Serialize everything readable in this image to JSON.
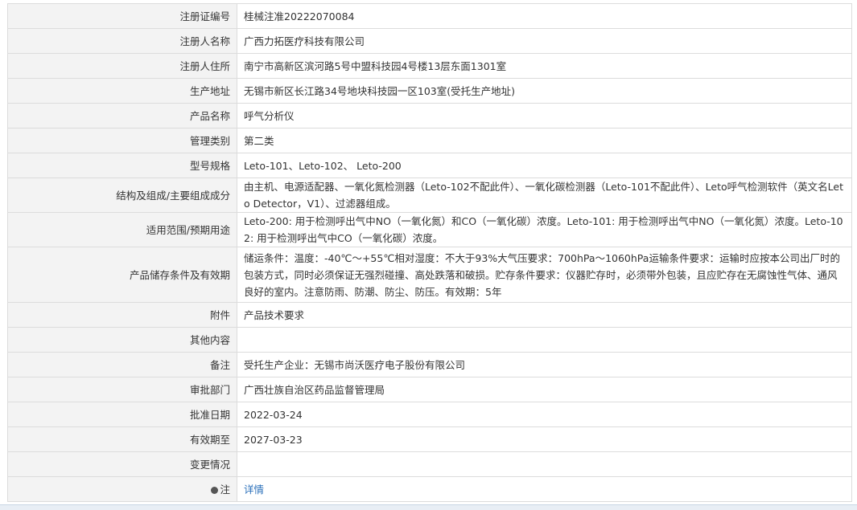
{
  "rows": [
    {
      "label": "注册证编号",
      "value": "桂械注准20222070084"
    },
    {
      "label": "注册人名称",
      "value": "广西力拓医疗科技有限公司"
    },
    {
      "label": "注册人住所",
      "value": "南宁市高新区滨河路5号中盟科技园4号楼13层东面1301室"
    },
    {
      "label": "生产地址",
      "value": "无锡市新区长江路34号地块科技园一区103室(受托生产地址)"
    },
    {
      "label": "产品名称",
      "value": "呼气分析仪"
    },
    {
      "label": "管理类别",
      "value": "第二类"
    },
    {
      "label": "型号规格",
      "value": "Leto-101、Leto-102、 Leto-200"
    },
    {
      "label": "结构及组成/主要组成成分",
      "value": "由主机、电源适配器、一氧化氮检测器（Leto-102不配此件）、一氧化碳检测器（Leto-101不配此件）、Leto呼气检测软件（英文名Leto Detector，V1）、过滤器组成。"
    },
    {
      "label": "适用范围/预期用途",
      "value": "Leto-200: 用于检测呼出气中NO（一氧化氮）和CO（一氧化碳）浓度。Leto-101: 用于检测呼出气中NO（一氧化氮）浓度。Leto-102: 用于检测呼出气中CO（一氧化碳）浓度。"
    },
    {
      "label": "产品储存条件及有效期",
      "value": "储运条件：温度：-40℃～+55℃相对湿度：不大于93%大气压要求：700hPa～1060hPa运输条件要求：运输时应按本公司出厂时的包装方式，同时必须保证无强烈碰撞、高处跌落和破损。贮存条件要求：仪器贮存时，必须带外包装，且应贮存在无腐蚀性气体、通风良好的室内。注意防雨、防潮、防尘、防压。有效期：5年"
    },
    {
      "label": "附件",
      "value": "产品技术要求"
    },
    {
      "label": "其他内容",
      "value": ""
    },
    {
      "label": "备注",
      "value": "受托生产企业：无锡市尚沃医疗电子股份有限公司"
    },
    {
      "label": "审批部门",
      "value": "广西壮族自治区药品监督管理局"
    },
    {
      "label": "批准日期",
      "value": "2022-03-24"
    },
    {
      "label": "有效期至",
      "value": "2027-03-23"
    },
    {
      "label": "变更情况",
      "value": ""
    }
  ],
  "note": {
    "label": "注",
    "link_text": "详情",
    "icon": "pin-icon"
  }
}
